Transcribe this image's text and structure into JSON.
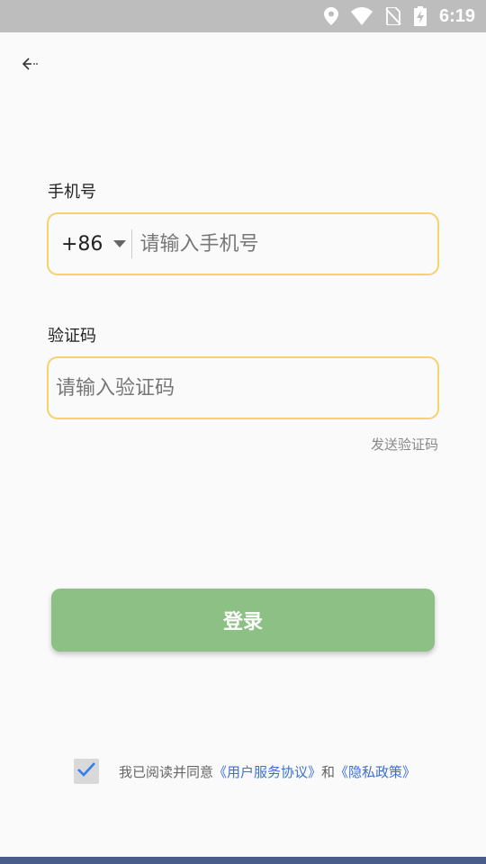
{
  "status_bar": {
    "time": "6:19",
    "icons": [
      "location-icon",
      "wifi-icon",
      "no-sim-icon",
      "battery-charging-icon"
    ]
  },
  "nav": {
    "back_icon": "back-arrow-icon"
  },
  "phone": {
    "label": "手机号",
    "country_code": "+86",
    "placeholder": "请输入手机号",
    "value": ""
  },
  "code": {
    "label": "验证码",
    "placeholder": "请输入验证码",
    "value": "",
    "send_label": "发送验证码"
  },
  "login": {
    "label": "登录"
  },
  "agreement": {
    "checked": true,
    "prefix": "我已阅读并同意",
    "user_agreement": "《用户服务协议》",
    "conjunction": "和",
    "privacy_policy": "《隐私政策》"
  },
  "colors": {
    "accent": "#f5d36a",
    "login_button": "#8cc084",
    "link": "#3d6fd6",
    "checkmark": "#2f80ed"
  }
}
